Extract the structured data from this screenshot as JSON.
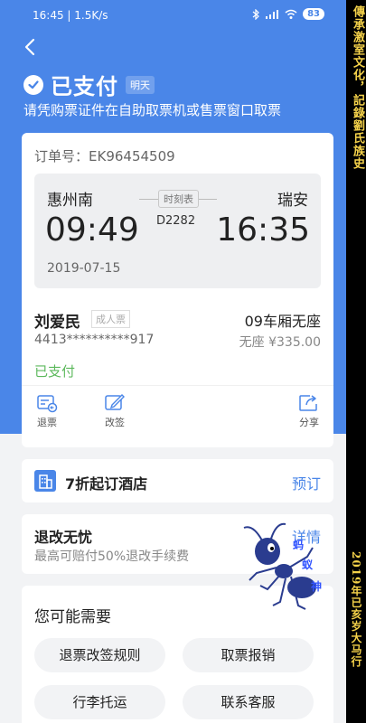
{
  "statusbar": {
    "time": "16:45",
    "speed": "1.5K/s",
    "battery": "83"
  },
  "header": {
    "status_title": "已支付",
    "day_tag": "明天",
    "tip": "请凭购票证件在自助取票机或售票窗口取票"
  },
  "order": {
    "order_no": "订单号：EK96454509",
    "from_station": "惠州南",
    "to_station": "瑞安",
    "timetable_label": "时刻表",
    "train_no": "D2282",
    "depart_time": "09:49",
    "arrive_time": "16:35",
    "date": "2019-07-15",
    "passenger_name": "刘爱民",
    "ticket_type": "成人票",
    "seat": "09车厢无座",
    "id_number": "4413**********917",
    "price": "无座 ¥335.00",
    "pay_status": "已支付",
    "actions": {
      "refund": "退票",
      "change": "改签",
      "share": "分享"
    }
  },
  "hotel": {
    "text": "7折起订酒店",
    "link": "预订"
  },
  "insurance": {
    "title": "退改无忧",
    "subtitle": "最高可赔付50%退改手续费",
    "link": "详情"
  },
  "needs": {
    "title": "您可能需要",
    "buttons": [
      "退票改签规则",
      "取票报销",
      "行李托运",
      "联系客服"
    ]
  },
  "watermark": {
    "chars": [
      "蚂",
      "蚁",
      "神"
    ]
  },
  "banner": {
    "top_text": "傳承激室文化，記錄劉氏族史",
    "bottom_text": "2019年已亥岁大马行"
  },
  "colors": {
    "primary": "#4a86e8",
    "paid_green": "#5cb85c",
    "banner_gold": "#f5d24a"
  }
}
